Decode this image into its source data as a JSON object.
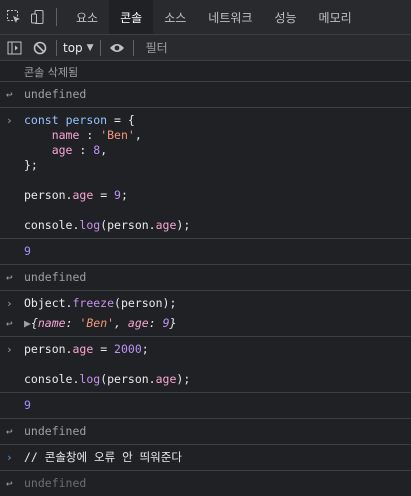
{
  "tabs": {
    "items": [
      "요소",
      "콘솔",
      "소스",
      "네트워크",
      "성능",
      "메모리"
    ],
    "active": "콘솔"
  },
  "toolbar": {
    "context": "top",
    "filter_placeholder": "필터"
  },
  "console": {
    "cleared": "콘솔 삭제됨",
    "undefined": "undefined",
    "code1": {
      "const": "const",
      "person": "person",
      "eq": "=",
      "open": "{",
      "name_key": "name",
      "name_val": "'Ben'",
      "age_key": "age",
      "age_val": "8",
      "close": "};"
    },
    "code2": {
      "obj": "person",
      "prop": "age",
      "val": "9"
    },
    "code3": {
      "console": "console",
      "log": "log",
      "obj": "person",
      "prop": "age"
    },
    "out1": "9",
    "code4": {
      "object": "Object",
      "freeze": "freeze",
      "arg": "person"
    },
    "obj_preview": {
      "name_key": "name",
      "name_val": "'Ben'",
      "age_key": "age",
      "age_val": "9"
    },
    "code5": {
      "obj": "person",
      "prop": "age",
      "val": "2000"
    },
    "code6": {
      "console": "console",
      "log": "log",
      "obj": "person",
      "prop": "age"
    },
    "out2": "9",
    "comment": "// 콘솔창에 오류 안 띄워준다",
    "last_undefined": "undefined"
  }
}
